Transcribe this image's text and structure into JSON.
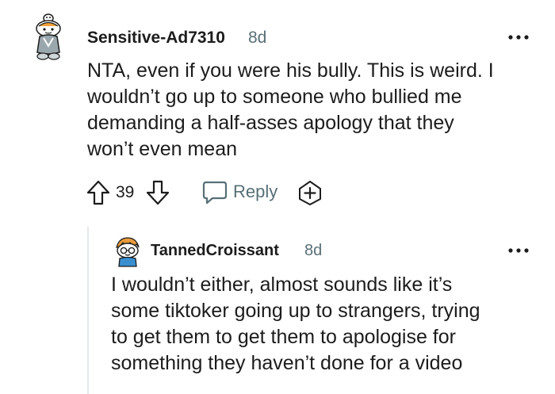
{
  "comments": [
    {
      "username": "Sensitive-Ad7310",
      "time": "8d",
      "avatar_icon": "snoo-avatar-icon",
      "body_lines": [
        "NTA, even if you were his bully. This is weird. I",
        "wouldn’t go up to someone who bullied me",
        "demanding a half-asses apology that they",
        "won’t even mean"
      ],
      "votes": "39",
      "reply_label": "Reply"
    },
    {
      "username": "TannedCroissant",
      "time": "8d",
      "avatar_icon": "snoo-avatar-icon",
      "body_lines": [
        "I wouldn’t either, almost sounds like it’s",
        "some tiktoker going up to strangers, trying",
        "to get them to get them to apologise for",
        "something they haven’t done for a video"
      ]
    }
  ],
  "icons": {
    "more": "more-options-icon",
    "upvote": "upvote-arrow-icon",
    "downvote": "downvote-arrow-icon",
    "reply": "speech-bubble-icon",
    "award": "award-plus-icon"
  },
  "colors": {
    "text": "#1c1c1c",
    "meta": "#576f76",
    "thread": "#e5e9eb"
  }
}
